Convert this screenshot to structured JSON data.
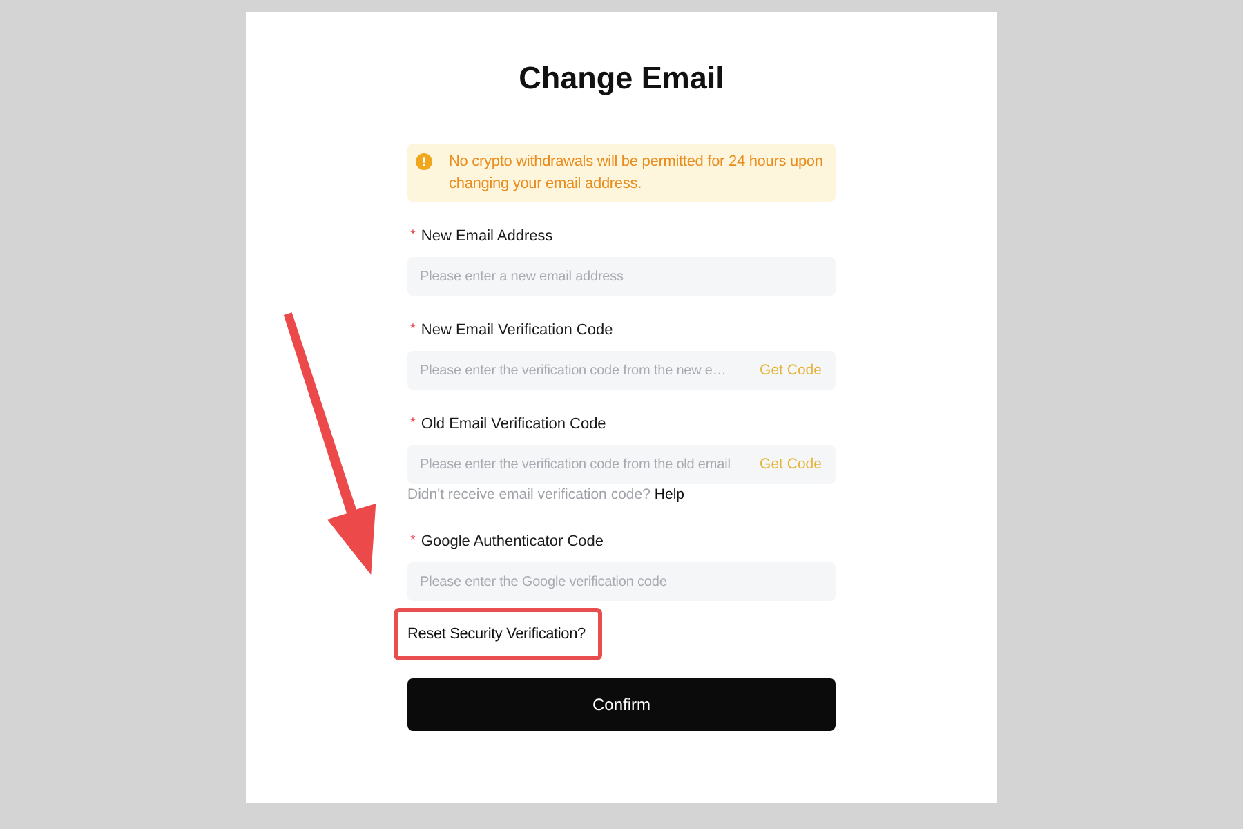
{
  "title": "Change Email",
  "notice": {
    "text": "No crypto withdrawals will be permitted for 24 hours upon changing your email address."
  },
  "fields": [
    {
      "required_mark": "*",
      "label": "New Email Address",
      "placeholder": "Please enter a new email address"
    },
    {
      "required_mark": "*",
      "label": "New Email Verification Code",
      "placeholder": "Please enter the verification code from the new e…",
      "action": "Get Code"
    },
    {
      "required_mark": "*",
      "label": "Old Email Verification Code",
      "placeholder": "Please enter the verification code from the old email",
      "action": "Get Code",
      "hint": "Didn't receive email verification code?",
      "hint_link": "Help"
    },
    {
      "required_mark": "*",
      "label": "Google Authenticator Code",
      "placeholder": "Please enter the Google verification code"
    }
  ],
  "reset_link": {
    "text": "Reset Security Verification?",
    "highlighted": true
  },
  "confirm_button": "Confirm"
}
